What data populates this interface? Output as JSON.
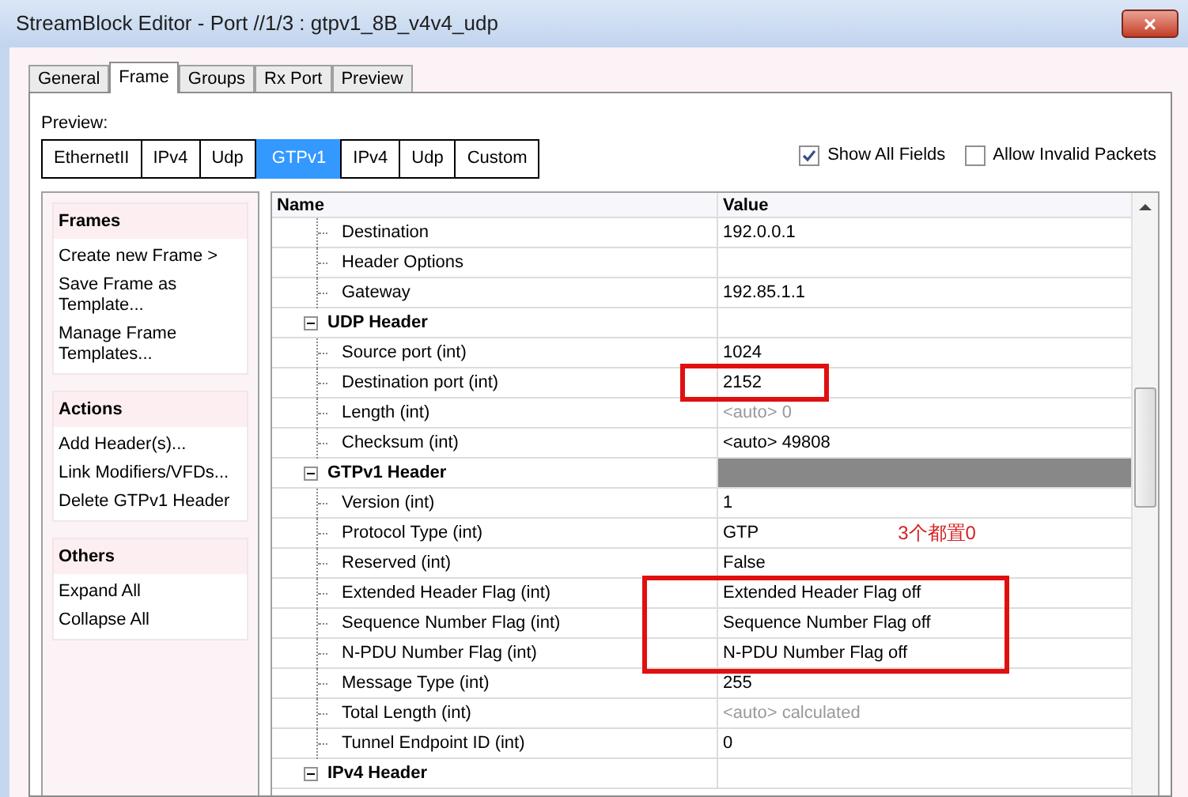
{
  "window": {
    "title": "StreamBlock Editor - Port //1/3 : gtpv1_8B_v4v4_udp",
    "close": "×"
  },
  "tabs": [
    {
      "label": "General",
      "selected": false
    },
    {
      "label": "Frame",
      "selected": true
    },
    {
      "label": "Groups",
      "selected": false
    },
    {
      "label": "Rx Port",
      "selected": false
    },
    {
      "label": "Preview",
      "selected": false
    }
  ],
  "preview": {
    "label": "Preview:",
    "items": [
      {
        "label": "EthernetII",
        "selected": false
      },
      {
        "label": "IPv4",
        "selected": false
      },
      {
        "label": "Udp",
        "selected": false
      },
      {
        "label": "GTPv1",
        "selected": true
      },
      {
        "label": "IPv4",
        "selected": false
      },
      {
        "label": "Udp",
        "selected": false
      },
      {
        "label": "Custom",
        "selected": false
      }
    ]
  },
  "options": [
    {
      "label": "Show All Fields",
      "checked": true
    },
    {
      "label": "Allow Invalid Packets",
      "checked": false
    }
  ],
  "sidebar": [
    {
      "title": "Frames",
      "items": [
        "Create new Frame >",
        "Save Frame as Template...",
        "Manage Frame Templates..."
      ]
    },
    {
      "title": "Actions",
      "items": [
        "Add Header(s)...",
        "Link Modifiers/VFDs...",
        "Delete GTPv1 Header"
      ]
    },
    {
      "title": "Others",
      "items": [
        "Expand All",
        "Collapse All"
      ]
    }
  ],
  "tree": {
    "columns": [
      "Name",
      "Value"
    ],
    "rows": [
      {
        "name": "Destination",
        "value": "192.0.0.1",
        "auto": false,
        "selected": false,
        "highlighted": false
      },
      {
        "name": "Header Options",
        "selected": false,
        "highlighted": false
      },
      {
        "name": "Gateway",
        "value": "192.85.1.1",
        "auto": false,
        "selected": false,
        "highlighted": false
      },
      {
        "name": "UDP Header",
        "expanded": true,
        "selected": false,
        "highlighted": false,
        "children": [
          {
            "name": "Source port (int)",
            "value": "1024",
            "auto": false,
            "selected": false,
            "highlighted": false
          },
          {
            "name": "Destination port (int)",
            "value": "2152",
            "auto": false,
            "selected": false,
            "highlighted": true
          },
          {
            "name": "Length (int)",
            "value": "<auto> 0",
            "auto": true,
            "selected": false,
            "highlighted": false
          },
          {
            "name": "Checksum (int)",
            "value": "<auto> 49808",
            "auto": false,
            "selected": false,
            "highlighted": false
          }
        ]
      },
      {
        "name": "GTPv1 Header",
        "expanded": true,
        "selected": true,
        "highlighted": false,
        "children": [
          {
            "name": "Version (int)",
            "value": "1",
            "auto": false,
            "selected": false,
            "highlighted": false
          },
          {
            "name": "Protocol Type (int)",
            "value": "GTP",
            "auto": false,
            "selected": false,
            "highlighted": false,
            "note": "3个都置0"
          },
          {
            "name": "Reserved (int)",
            "value": "False",
            "auto": false,
            "selected": false,
            "highlighted": false
          },
          {
            "name": "Extended Header Flag (int)",
            "value": "Extended Header Flag off",
            "auto": false,
            "selected": false,
            "highlighted": true
          },
          {
            "name": "Sequence Number Flag (int)",
            "value": "Sequence Number Flag off",
            "auto": false,
            "selected": false,
            "highlighted": true
          },
          {
            "name": "N-PDU Number Flag (int)",
            "value": "N-PDU Number Flag off",
            "auto": false,
            "selected": false,
            "highlighted": true
          },
          {
            "name": "Message Type (int)",
            "value": "255",
            "auto": false,
            "selected": false,
            "highlighted": false
          },
          {
            "name": "Total Length (int)",
            "value": "<auto> calculated",
            "auto": true,
            "selected": false,
            "highlighted": false
          },
          {
            "name": "Tunnel Endpoint ID (int)",
            "value": "0",
            "auto": false,
            "selected": false,
            "highlighted": false
          }
        ]
      },
      {
        "name": "IPv4 Header",
        "expanded": true,
        "selected": false,
        "highlighted": false
      }
    ]
  }
}
